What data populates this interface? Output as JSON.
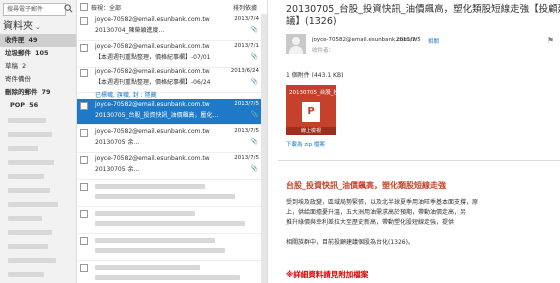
{
  "folders": {
    "search_placeholder": "搜尋電子郵件",
    "header": "資料夾",
    "items": [
      {
        "label": "收件匣",
        "count": "49"
      },
      {
        "label": "垃圾郵件",
        "count": "105"
      },
      {
        "label": "草稿",
        "count": "2"
      },
      {
        "label": "寄件備份",
        "count": ""
      },
      {
        "label": "刪除的郵件",
        "count": "79"
      },
      {
        "label": "POP",
        "count": "56"
      }
    ]
  },
  "list": {
    "filter_label": "檢視：全部",
    "sort_label": "排列依據",
    "messages": [
      {
        "from": "joyce-70582@email.esunbank.com.tw",
        "subject": "20130704_陳榮穎進度...",
        "date": "2013/7/4"
      },
      {
        "from": "joyce-70582@email.esunbank.com.tw",
        "subject": "【本週週刊重點整理，價格紀事欄】-07/01",
        "date": "2013/7/1"
      },
      {
        "from": "joyce-70582@email.esunbank.com.tw",
        "subject": "【本週週刊重點整理，價格紀事欄】-06/24",
        "date": "2013/6/24"
      },
      {
        "from": "joyce-70582@email.esunbank.com.tw",
        "subject": "20130705_台股_投資快訊_油價飆高，壓化...",
        "date": "2013/7/5"
      },
      {
        "from": "joyce-70582@email.esunbank.com.tw",
        "subject": "20130705 余...",
        "date": "2013/7/5"
      },
      {
        "from": "joyce-70582@email.esunbank.com.tw",
        "subject": "20130705 余...",
        "date": "2013/7/5"
      }
    ],
    "separator": "已標幟, 旗幟, 封 : 隱藏"
  },
  "reading": {
    "title": "20130705_台股_投資快訊_油價飆高，塑化類股短線走強【投顧建議】(1326)",
    "from": "joyce-70582@email.esunbank.com.tw",
    "date": "2013/7/5",
    "related": "相關",
    "to": "收件者：",
    "attachment_count": "1 個附件 (443.1 KB)",
    "tile_name": "20130705_台股_投...",
    "tile_letter": "P",
    "tile_button": "線上檢視",
    "download": "下載為 zip 檔案",
    "headline": "台股_投資快訊_油價飆高，塑化類股短線走強",
    "body_lines": [
      "受到埃及政變，區域局勢緊張，以及北半球夏季用油旺季基本面支撐，原",
      "上，供給面擔憂升溫，五大洲用油需求高於預期，帶動油價走高，另",
      "推升綠價與幸利差拉大至歷史新高，帶動塑化股短線走強，提供"
    ],
    "body_line2": "相關族群中，目前投顧建議個股為台化(1326)。",
    "attach_note": "※詳細資料請見附加檔案"
  }
}
